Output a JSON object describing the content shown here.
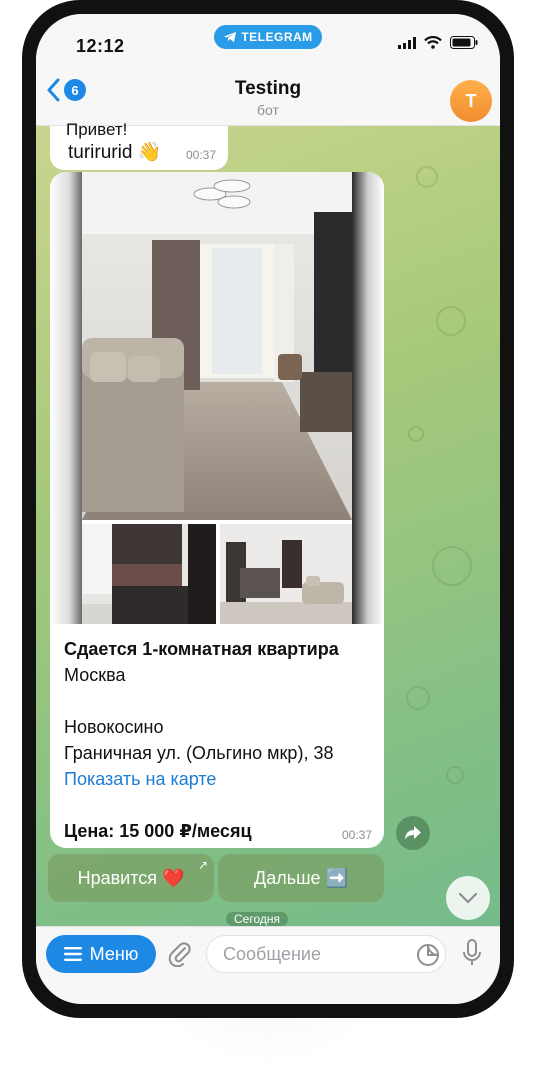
{
  "status_bar": {
    "time": "12:12",
    "app_pill": "TELEGRAM"
  },
  "header": {
    "back_count": "6",
    "title": "Testing",
    "subtitle": "бот",
    "avatar_letter": "T"
  },
  "messages": {
    "first": {
      "partial_text": "Привет!",
      "name": "turirurid 👋",
      "time": "00:37"
    },
    "listing": {
      "title": "Сдается 1-комнатная квартира",
      "city": "Москва",
      "district": "Новокосино",
      "address": "Граничная ул. (Ольгино мкр), 38",
      "map_link": "Показать на карте",
      "price": "Цена: 15 000 ₽/месяц",
      "time": "00:37"
    }
  },
  "keyboard": {
    "like": "Нравится ❤️",
    "next": "Дальше ➡️",
    "corner_arrow": "↗"
  },
  "date_chip": "Сегодня",
  "input": {
    "menu_label": "Меню",
    "placeholder": "Сообщение"
  },
  "colors": {
    "accent": "#1e88e5",
    "avatar": "#f39a35",
    "chat_bg_start": "#c9d58e",
    "chat_bg_end": "#6fb98c"
  }
}
